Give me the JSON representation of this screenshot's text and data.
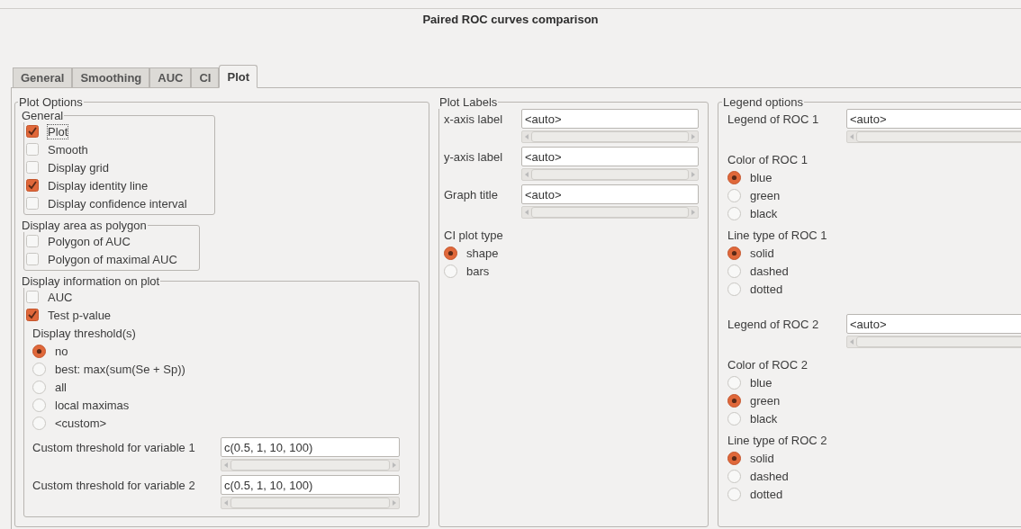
{
  "window": {
    "title": "Paired ROC curves comparison"
  },
  "tabs": [
    {
      "label": "General",
      "selected": false
    },
    {
      "label": "Smoothing",
      "selected": false
    },
    {
      "label": "AUC",
      "selected": false
    },
    {
      "label": "CI",
      "selected": false
    },
    {
      "label": "Plot",
      "selected": true
    }
  ],
  "plot_options": {
    "title": "Plot Options",
    "general": {
      "title": "General",
      "items": [
        {
          "label": "Plot",
          "checked": true,
          "focused": true
        },
        {
          "label": "Smooth",
          "checked": false
        },
        {
          "label": "Display grid",
          "checked": false
        },
        {
          "label": "Display identity line",
          "checked": true
        },
        {
          "label": "Display confidence interval",
          "checked": false
        }
      ]
    },
    "polygon": {
      "title": "Display area as polygon",
      "items": [
        {
          "label": "Polygon of AUC",
          "checked": false
        },
        {
          "label": "Polygon of maximal AUC",
          "checked": false
        }
      ]
    },
    "info": {
      "title": "Display information on plot",
      "items": [
        {
          "label": "AUC",
          "checked": false
        },
        {
          "label": "Test p-value",
          "checked": true
        }
      ],
      "threshold": {
        "label": "Display threshold(s)",
        "options": [
          {
            "label": "no",
            "selected": true
          },
          {
            "label": "best: max(sum(Se + Sp))",
            "selected": false
          },
          {
            "label": "all",
            "selected": false
          },
          {
            "label": "local maximas",
            "selected": false
          },
          {
            "label": "<custom>",
            "selected": false
          }
        ]
      },
      "custom_fields": [
        {
          "label": "Custom threshold for variable 1",
          "value": "c(0.5, 1, 10, 100)"
        },
        {
          "label": "Custom threshold for variable 2",
          "value": "c(0.5, 1, 10, 100)"
        }
      ]
    }
  },
  "plot_labels": {
    "title": "Plot Labels",
    "fields": [
      {
        "label": "x-axis label",
        "value": "<auto>"
      },
      {
        "label": "y-axis label",
        "value": "<auto>"
      },
      {
        "label": "Graph title",
        "value": "<auto>"
      }
    ],
    "ci_plot_type": {
      "label": "CI plot type",
      "options": [
        {
          "label": "shape",
          "selected": true
        },
        {
          "label": "bars",
          "selected": false
        }
      ]
    }
  },
  "legend_options": {
    "title": "Legend options",
    "rocs": [
      {
        "legend": {
          "label": "Legend of ROC 1",
          "value": "<auto>"
        },
        "color": {
          "label": "Color of ROC 1",
          "options": [
            {
              "label": "blue",
              "selected": true
            },
            {
              "label": "green",
              "selected": false
            },
            {
              "label": "black",
              "selected": false
            }
          ]
        },
        "line_type": {
          "label": "Line type of ROC 1",
          "options": [
            {
              "label": "solid",
              "selected": true
            },
            {
              "label": "dashed",
              "selected": false
            },
            {
              "label": "dotted",
              "selected": false
            }
          ]
        }
      },
      {
        "legend": {
          "label": "Legend of ROC 2",
          "value": "<auto>"
        },
        "color": {
          "label": "Color of ROC 2",
          "options": [
            {
              "label": "blue",
              "selected": false
            },
            {
              "label": "green",
              "selected": true
            },
            {
              "label": "black",
              "selected": false
            }
          ]
        },
        "line_type": {
          "label": "Line type of ROC 2",
          "options": [
            {
              "label": "solid",
              "selected": true
            },
            {
              "label": "dashed",
              "selected": false
            },
            {
              "label": "dotted",
              "selected": false
            }
          ]
        }
      }
    ]
  }
}
